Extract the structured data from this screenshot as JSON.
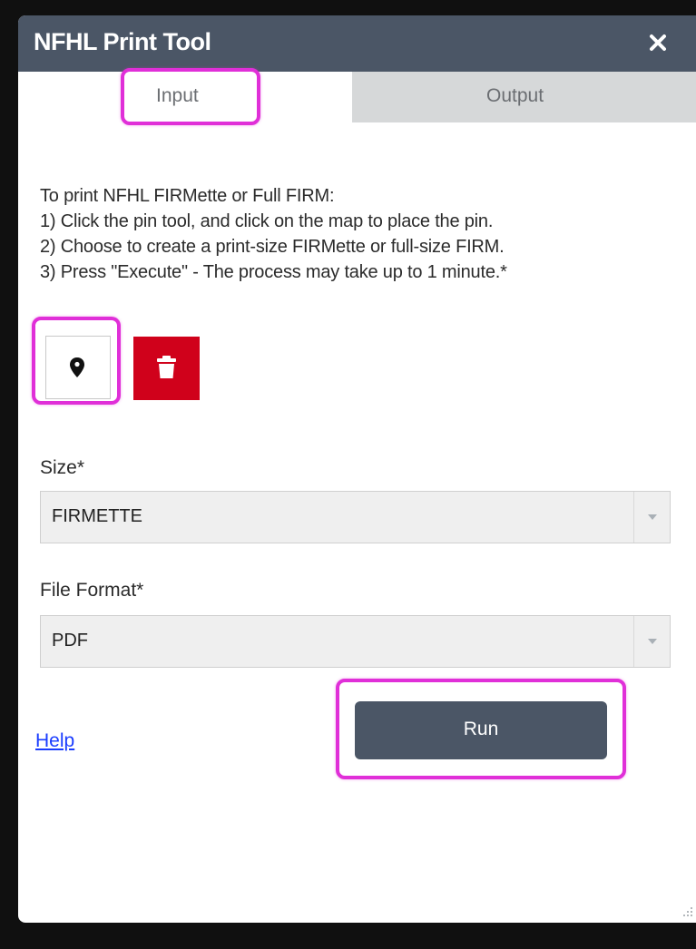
{
  "window": {
    "title": "NFHL Print Tool",
    "close_icon": "close-icon"
  },
  "tabs": [
    {
      "label": "Input",
      "active": true
    },
    {
      "label": "Output",
      "active": false
    }
  ],
  "instructions": [
    "To print NFHL FIRMette or Full FIRM:",
    "1) Click the pin tool, and click on the map to place the pin.",
    "2) Choose to create a print-size FIRMette or full-size FIRM.",
    "3) Press \"Execute\" - The process may take up to 1 minute.*"
  ],
  "tools": {
    "pin_icon": "map-pin-icon",
    "trash_icon": "trash-icon"
  },
  "size": {
    "label": "Size*",
    "value": "FIRMETTE"
  },
  "file_format": {
    "label": "File Format*",
    "value": "PDF"
  },
  "help_label": "Help",
  "run_label": "Run",
  "colors": {
    "header": "#4b5666",
    "highlight": "#e02fd8",
    "trash_button": "#d0011b",
    "inactive_tab": "#d6d8d9",
    "link": "#1a3cff"
  }
}
